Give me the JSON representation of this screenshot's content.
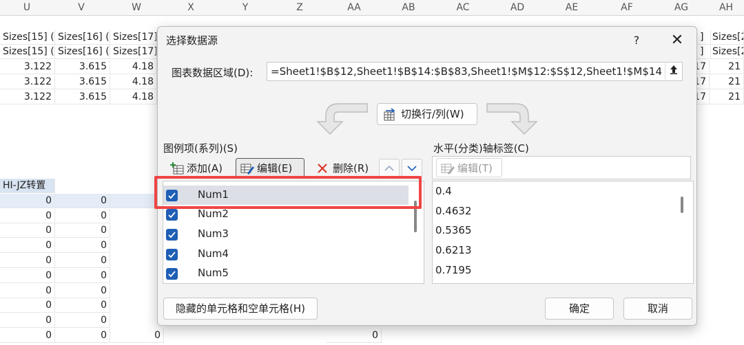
{
  "sheet": {
    "columns": [
      "U",
      "V",
      "W",
      "X",
      "Y",
      "Z",
      "AA",
      "AB",
      "AC",
      "AD",
      "AE",
      "AF",
      "AG",
      "AH"
    ],
    "row_sizes_1": [
      "Sizes[15] (",
      "Sizes[16] (",
      "Sizes[17]"
    ],
    "row_sizes_2": [
      "Sizes[15] (",
      "Sizes[16] (",
      "Sizes[17]"
    ],
    "values_row": [
      "3.122",
      "3.615",
      "4.18"
    ],
    "right_partial_sizes": [
      "Sizes[2",
      "Sizes[2"
    ],
    "right_partial_values": [
      "17",
      "21"
    ],
    "left_label": "HI-JZ转置",
    "zero": "0"
  },
  "dialog": {
    "title": "选择数据源",
    "help": "?",
    "close": "✕",
    "range_label": "图表数据区域(D):",
    "range_value": "=Sheet1!$B$12,Sheet1!$B$14:$B$83,Sheet1!$M$12:$S$12,Sheet1!$M$14",
    "switch_label": "切换行/列(W)",
    "series_section": "图例项(系列)(S)",
    "axis_section": "水平(分类)轴标签(C)",
    "add_label": "添加(A)",
    "edit_label": "编辑(E)",
    "delete_label": "删除(R)",
    "axis_edit_label": "编辑(T)",
    "series": [
      "Num1",
      "Num2",
      "Num3",
      "Num4",
      "Num5"
    ],
    "axis_labels": [
      "0.4",
      "0.4632",
      "0.5365",
      "0.6213",
      "0.7195"
    ],
    "hidden_cells_label": "隐藏的单元格和空单元格(H)",
    "ok_label": "确定",
    "cancel_label": "取消",
    "colors": {
      "accent": "#1f5fb5",
      "highlight": "#ef4444"
    }
  }
}
